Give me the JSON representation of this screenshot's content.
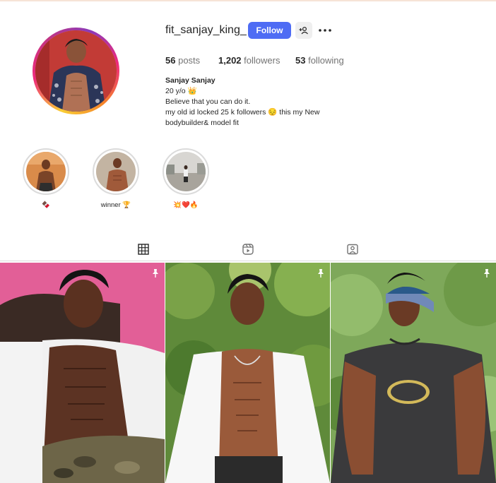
{
  "profile": {
    "username": "fit_sanjay_king_",
    "follow_label": "Follow",
    "stats": {
      "posts_count": "56",
      "posts_label": "posts",
      "followers_count": "1,202",
      "followers_label": "followers",
      "following_count": "53",
      "following_label": "following"
    },
    "bio": {
      "name": "Sanjay Sanjay",
      "line1": "20 y/o 👑",
      "line2": "Believe that you can do it.",
      "line3": "my old id locked 25 k followers 😔 this my New",
      "line4": "bodybuilder& model fit"
    }
  },
  "highlights": [
    {
      "label": "🍫"
    },
    {
      "label": "winner 🏆"
    },
    {
      "label": "💥❤️🔥"
    }
  ],
  "tabs": [
    {
      "name": "posts",
      "icon": "grid-icon",
      "active": true
    },
    {
      "name": "reels",
      "icon": "reels-icon",
      "active": false
    },
    {
      "name": "tagged",
      "icon": "tagged-icon",
      "active": false
    }
  ],
  "posts": [
    {
      "pinned": true,
      "icon": "pin-icon"
    },
    {
      "pinned": true,
      "icon": "pin-icon"
    },
    {
      "pinned": true,
      "icon": "pin-icon"
    }
  ],
  "colors": {
    "follow_button": "#4e6cf4",
    "text": "#262626",
    "muted": "#737373"
  }
}
